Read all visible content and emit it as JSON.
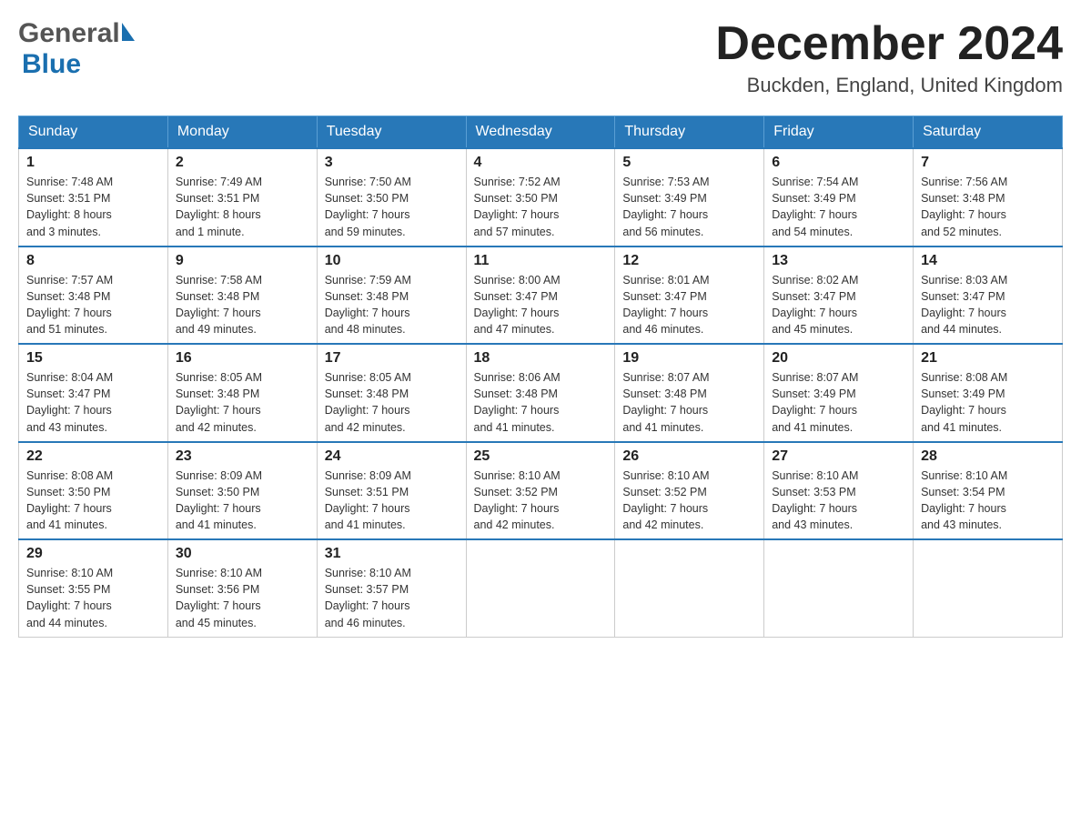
{
  "header": {
    "logo_general": "General",
    "logo_blue": "Blue",
    "month_title": "December 2024",
    "location": "Buckden, England, United Kingdom"
  },
  "days_of_week": [
    "Sunday",
    "Monday",
    "Tuesday",
    "Wednesday",
    "Thursday",
    "Friday",
    "Saturday"
  ],
  "weeks": [
    [
      {
        "day": "1",
        "sunrise": "Sunrise: 7:48 AM",
        "sunset": "Sunset: 3:51 PM",
        "daylight": "Daylight: 8 hours",
        "daylight2": "and 3 minutes."
      },
      {
        "day": "2",
        "sunrise": "Sunrise: 7:49 AM",
        "sunset": "Sunset: 3:51 PM",
        "daylight": "Daylight: 8 hours",
        "daylight2": "and 1 minute."
      },
      {
        "day": "3",
        "sunrise": "Sunrise: 7:50 AM",
        "sunset": "Sunset: 3:50 PM",
        "daylight": "Daylight: 7 hours",
        "daylight2": "and 59 minutes."
      },
      {
        "day": "4",
        "sunrise": "Sunrise: 7:52 AM",
        "sunset": "Sunset: 3:50 PM",
        "daylight": "Daylight: 7 hours",
        "daylight2": "and 57 minutes."
      },
      {
        "day": "5",
        "sunrise": "Sunrise: 7:53 AM",
        "sunset": "Sunset: 3:49 PM",
        "daylight": "Daylight: 7 hours",
        "daylight2": "and 56 minutes."
      },
      {
        "day": "6",
        "sunrise": "Sunrise: 7:54 AM",
        "sunset": "Sunset: 3:49 PM",
        "daylight": "Daylight: 7 hours",
        "daylight2": "and 54 minutes."
      },
      {
        "day": "7",
        "sunrise": "Sunrise: 7:56 AM",
        "sunset": "Sunset: 3:48 PM",
        "daylight": "Daylight: 7 hours",
        "daylight2": "and 52 minutes."
      }
    ],
    [
      {
        "day": "8",
        "sunrise": "Sunrise: 7:57 AM",
        "sunset": "Sunset: 3:48 PM",
        "daylight": "Daylight: 7 hours",
        "daylight2": "and 51 minutes."
      },
      {
        "day": "9",
        "sunrise": "Sunrise: 7:58 AM",
        "sunset": "Sunset: 3:48 PM",
        "daylight": "Daylight: 7 hours",
        "daylight2": "and 49 minutes."
      },
      {
        "day": "10",
        "sunrise": "Sunrise: 7:59 AM",
        "sunset": "Sunset: 3:48 PM",
        "daylight": "Daylight: 7 hours",
        "daylight2": "and 48 minutes."
      },
      {
        "day": "11",
        "sunrise": "Sunrise: 8:00 AM",
        "sunset": "Sunset: 3:47 PM",
        "daylight": "Daylight: 7 hours",
        "daylight2": "and 47 minutes."
      },
      {
        "day": "12",
        "sunrise": "Sunrise: 8:01 AM",
        "sunset": "Sunset: 3:47 PM",
        "daylight": "Daylight: 7 hours",
        "daylight2": "and 46 minutes."
      },
      {
        "day": "13",
        "sunrise": "Sunrise: 8:02 AM",
        "sunset": "Sunset: 3:47 PM",
        "daylight": "Daylight: 7 hours",
        "daylight2": "and 45 minutes."
      },
      {
        "day": "14",
        "sunrise": "Sunrise: 8:03 AM",
        "sunset": "Sunset: 3:47 PM",
        "daylight": "Daylight: 7 hours",
        "daylight2": "and 44 minutes."
      }
    ],
    [
      {
        "day": "15",
        "sunrise": "Sunrise: 8:04 AM",
        "sunset": "Sunset: 3:47 PM",
        "daylight": "Daylight: 7 hours",
        "daylight2": "and 43 minutes."
      },
      {
        "day": "16",
        "sunrise": "Sunrise: 8:05 AM",
        "sunset": "Sunset: 3:48 PM",
        "daylight": "Daylight: 7 hours",
        "daylight2": "and 42 minutes."
      },
      {
        "day": "17",
        "sunrise": "Sunrise: 8:05 AM",
        "sunset": "Sunset: 3:48 PM",
        "daylight": "Daylight: 7 hours",
        "daylight2": "and 42 minutes."
      },
      {
        "day": "18",
        "sunrise": "Sunrise: 8:06 AM",
        "sunset": "Sunset: 3:48 PM",
        "daylight": "Daylight: 7 hours",
        "daylight2": "and 41 minutes."
      },
      {
        "day": "19",
        "sunrise": "Sunrise: 8:07 AM",
        "sunset": "Sunset: 3:48 PM",
        "daylight": "Daylight: 7 hours",
        "daylight2": "and 41 minutes."
      },
      {
        "day": "20",
        "sunrise": "Sunrise: 8:07 AM",
        "sunset": "Sunset: 3:49 PM",
        "daylight": "Daylight: 7 hours",
        "daylight2": "and 41 minutes."
      },
      {
        "day": "21",
        "sunrise": "Sunrise: 8:08 AM",
        "sunset": "Sunset: 3:49 PM",
        "daylight": "Daylight: 7 hours",
        "daylight2": "and 41 minutes."
      }
    ],
    [
      {
        "day": "22",
        "sunrise": "Sunrise: 8:08 AM",
        "sunset": "Sunset: 3:50 PM",
        "daylight": "Daylight: 7 hours",
        "daylight2": "and 41 minutes."
      },
      {
        "day": "23",
        "sunrise": "Sunrise: 8:09 AM",
        "sunset": "Sunset: 3:50 PM",
        "daylight": "Daylight: 7 hours",
        "daylight2": "and 41 minutes."
      },
      {
        "day": "24",
        "sunrise": "Sunrise: 8:09 AM",
        "sunset": "Sunset: 3:51 PM",
        "daylight": "Daylight: 7 hours",
        "daylight2": "and 41 minutes."
      },
      {
        "day": "25",
        "sunrise": "Sunrise: 8:10 AM",
        "sunset": "Sunset: 3:52 PM",
        "daylight": "Daylight: 7 hours",
        "daylight2": "and 42 minutes."
      },
      {
        "day": "26",
        "sunrise": "Sunrise: 8:10 AM",
        "sunset": "Sunset: 3:52 PM",
        "daylight": "Daylight: 7 hours",
        "daylight2": "and 42 minutes."
      },
      {
        "day": "27",
        "sunrise": "Sunrise: 8:10 AM",
        "sunset": "Sunset: 3:53 PM",
        "daylight": "Daylight: 7 hours",
        "daylight2": "and 43 minutes."
      },
      {
        "day": "28",
        "sunrise": "Sunrise: 8:10 AM",
        "sunset": "Sunset: 3:54 PM",
        "daylight": "Daylight: 7 hours",
        "daylight2": "and 43 minutes."
      }
    ],
    [
      {
        "day": "29",
        "sunrise": "Sunrise: 8:10 AM",
        "sunset": "Sunset: 3:55 PM",
        "daylight": "Daylight: 7 hours",
        "daylight2": "and 44 minutes."
      },
      {
        "day": "30",
        "sunrise": "Sunrise: 8:10 AM",
        "sunset": "Sunset: 3:56 PM",
        "daylight": "Daylight: 7 hours",
        "daylight2": "and 45 minutes."
      },
      {
        "day": "31",
        "sunrise": "Sunrise: 8:10 AM",
        "sunset": "Sunset: 3:57 PM",
        "daylight": "Daylight: 7 hours",
        "daylight2": "and 46 minutes."
      },
      null,
      null,
      null,
      null
    ]
  ]
}
